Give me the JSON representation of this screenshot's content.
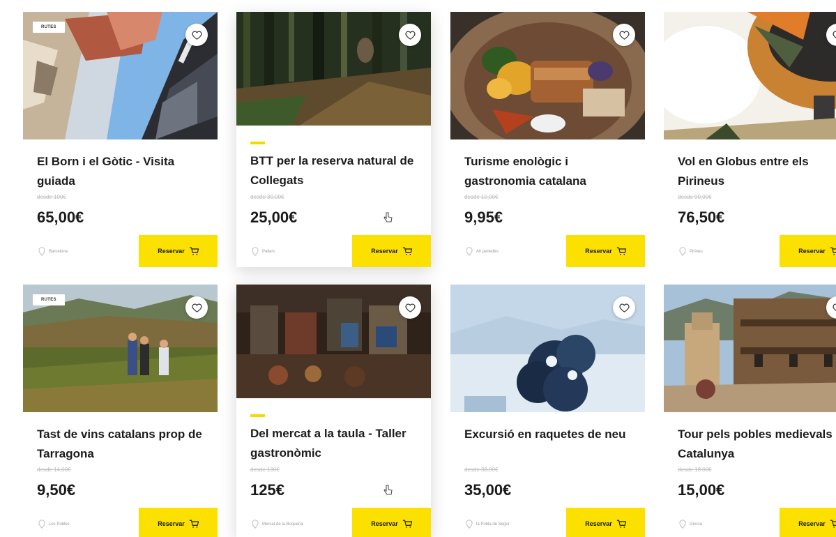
{
  "ui": {
    "book_label": "Reservar",
    "featured_tag": "RUTES"
  },
  "colors": {
    "accent": "#fbe000",
    "price_text": "#1a1a1a",
    "strike_text": "#bdbdbd"
  },
  "cards": [
    {
      "title": "El Born i el Gòtic - Visita guiada",
      "old_price": "desde 100€",
      "price": "65,00€",
      "location": "Barcelona",
      "tag": "RUTES",
      "image": "gothic-street-photo"
    },
    {
      "title": "BTT per la reserva natural de Collegats",
      "old_price": "desde 30,00€",
      "price": "25,00€",
      "location": "Pallars",
      "image": "forest-bike-photo"
    },
    {
      "title": "Turisme enològic i gastronomia catalana",
      "old_price": "desde 10,00€",
      "price": "9,95€",
      "location": "Alt penedès",
      "image": "food-plate-photo"
    },
    {
      "title": "Vol en Globus entre els Pirineus",
      "old_price": "desde 90,00€",
      "price": "76,50€",
      "location": "Pirineu",
      "image": "hot-air-balloon-photo"
    },
    {
      "title": "Tast de vins catalans prop de Tarragona",
      "old_price": "desde 14,00€",
      "price": "9,50€",
      "location": "Les Pobles",
      "tag": "RUTES",
      "image": "vineyard-people-photo"
    },
    {
      "title": "Del mercat a la taula - Taller gastronòmic",
      "old_price": "desde 130€",
      "price": "125€",
      "location": "Mercat de la Boqueria",
      "image": "market-stall-photo"
    },
    {
      "title": "Excursió en raquetes de neu",
      "old_price": "desde 38,00€",
      "price": "35,00€",
      "location": "la Pobla de Segur",
      "image": "snowy-tree-photo"
    },
    {
      "title": "Tour pels pobles medievals de Catalunya",
      "old_price": "desde 18,00€",
      "price": "15,00€",
      "location": "Girona",
      "image": "medieval-village-photo"
    }
  ]
}
